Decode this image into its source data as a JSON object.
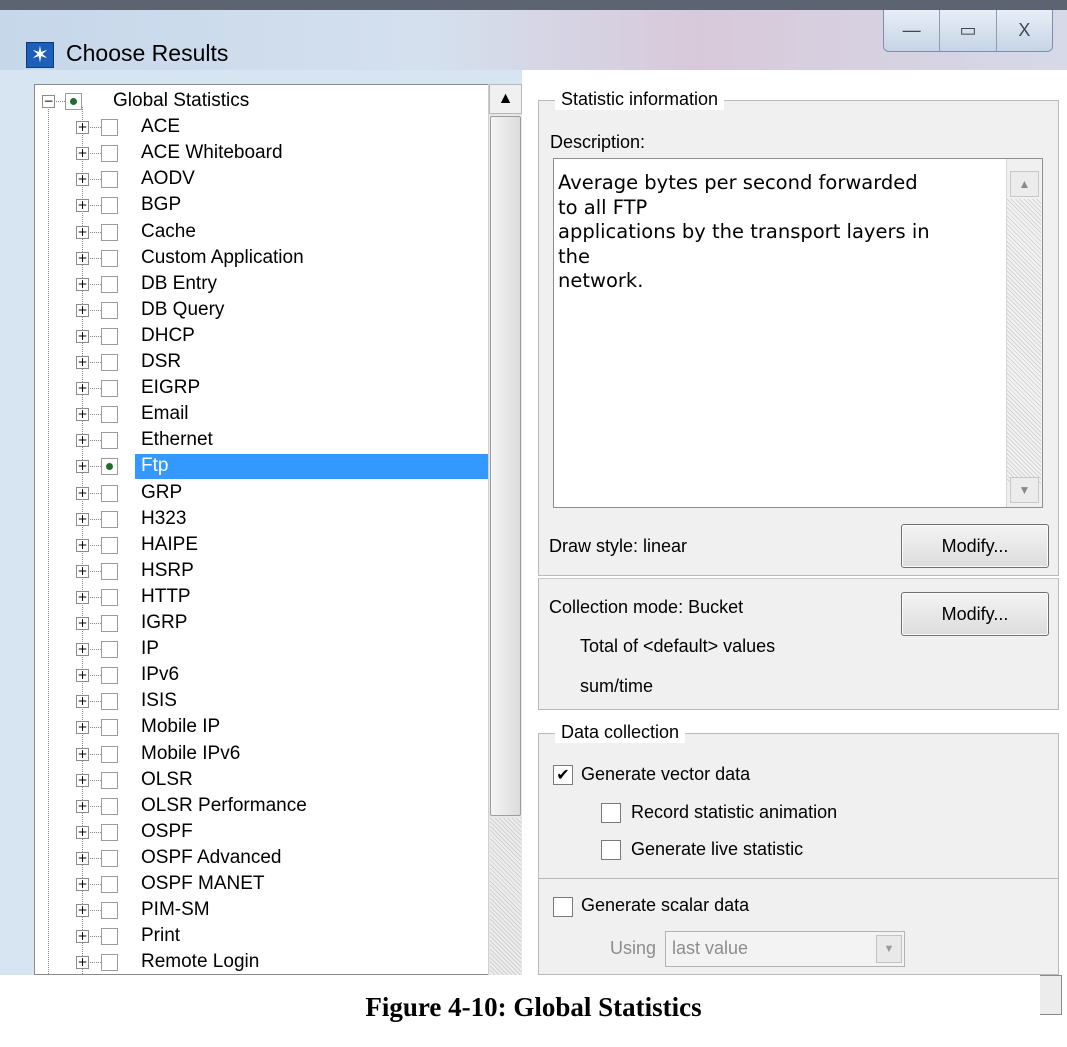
{
  "window": {
    "title": "Choose Results",
    "controls": {
      "minimize": "—",
      "maximize": "▭",
      "close": "X"
    }
  },
  "tree": {
    "root": {
      "label": "Global Statistics",
      "expander": "−"
    },
    "items": [
      {
        "label": "ACE",
        "expander": "+"
      },
      {
        "label": "ACE Whiteboard",
        "expander": "+"
      },
      {
        "label": "AODV",
        "expander": "+"
      },
      {
        "label": "BGP",
        "expander": "+"
      },
      {
        "label": "Cache",
        "expander": "+"
      },
      {
        "label": "Custom Application",
        "expander": "+"
      },
      {
        "label": "DB Entry",
        "expander": "+"
      },
      {
        "label": "DB Query",
        "expander": "+"
      },
      {
        "label": "DHCP",
        "expander": "+"
      },
      {
        "label": "DSR",
        "expander": "+"
      },
      {
        "label": "EIGRP",
        "expander": "+"
      },
      {
        "label": "Email",
        "expander": "+"
      },
      {
        "label": "Ethernet",
        "expander": "+"
      },
      {
        "label": "Ftp",
        "expander": "+"
      },
      {
        "label": "GRP",
        "expander": "+"
      },
      {
        "label": "H323",
        "expander": "+"
      },
      {
        "label": "HAIPE",
        "expander": "+"
      },
      {
        "label": "HSRP",
        "expander": "+"
      },
      {
        "label": "HTTP",
        "expander": "+"
      },
      {
        "label": "IGRP",
        "expander": "+"
      },
      {
        "label": "IP",
        "expander": "+"
      },
      {
        "label": "IPv6",
        "expander": "+"
      },
      {
        "label": "ISIS",
        "expander": "+"
      },
      {
        "label": "Mobile IP",
        "expander": "+"
      },
      {
        "label": "Mobile IPv6",
        "expander": "+"
      },
      {
        "label": "OLSR",
        "expander": "+"
      },
      {
        "label": "OLSR Performance",
        "expander": "+"
      },
      {
        "label": "OSPF",
        "expander": "+"
      },
      {
        "label": "OSPF Advanced",
        "expander": "+"
      },
      {
        "label": "OSPF MANET",
        "expander": "+"
      },
      {
        "label": "PIM-SM",
        "expander": "+"
      },
      {
        "label": "Print",
        "expander": "+"
      },
      {
        "label": "Remote Login",
        "expander": "+"
      }
    ],
    "selected": "Ftp",
    "scroll_up": "▲"
  },
  "statistic_info": {
    "legend": "Statistic information",
    "description_label": "Description:",
    "description": "Average bytes per second forwarded\nto all FTP\napplications by the transport layers in\nthe\nnetwork.",
    "desc_scroll_up": "▲",
    "desc_scroll_down": "▼",
    "draw_style": "Draw style: linear",
    "draw_modify": "Modify...",
    "collection_mode": "Collection mode: Bucket",
    "collection_modify": "Modify...",
    "total_line": "Total of <default> values",
    "sum_time": "sum/time"
  },
  "data_collection": {
    "legend": "Data collection",
    "generate_vector": {
      "label": "Generate vector data",
      "checked": true,
      "mark": "✔"
    },
    "record_animation": {
      "label": "Record statistic animation",
      "checked": false
    },
    "live_statistic": {
      "label": "Generate live statistic",
      "checked": false
    },
    "generate_scalar": {
      "label": "Generate scalar data",
      "checked": false
    },
    "using_label": "Using",
    "using_value": "last value",
    "dropdown": "▼"
  },
  "caption": "Figure 4-10: Global Statistics",
  "colors": {
    "selection": "#3399ff",
    "titlebar": "#c6d7ea",
    "dot": "#1f6e2c"
  }
}
